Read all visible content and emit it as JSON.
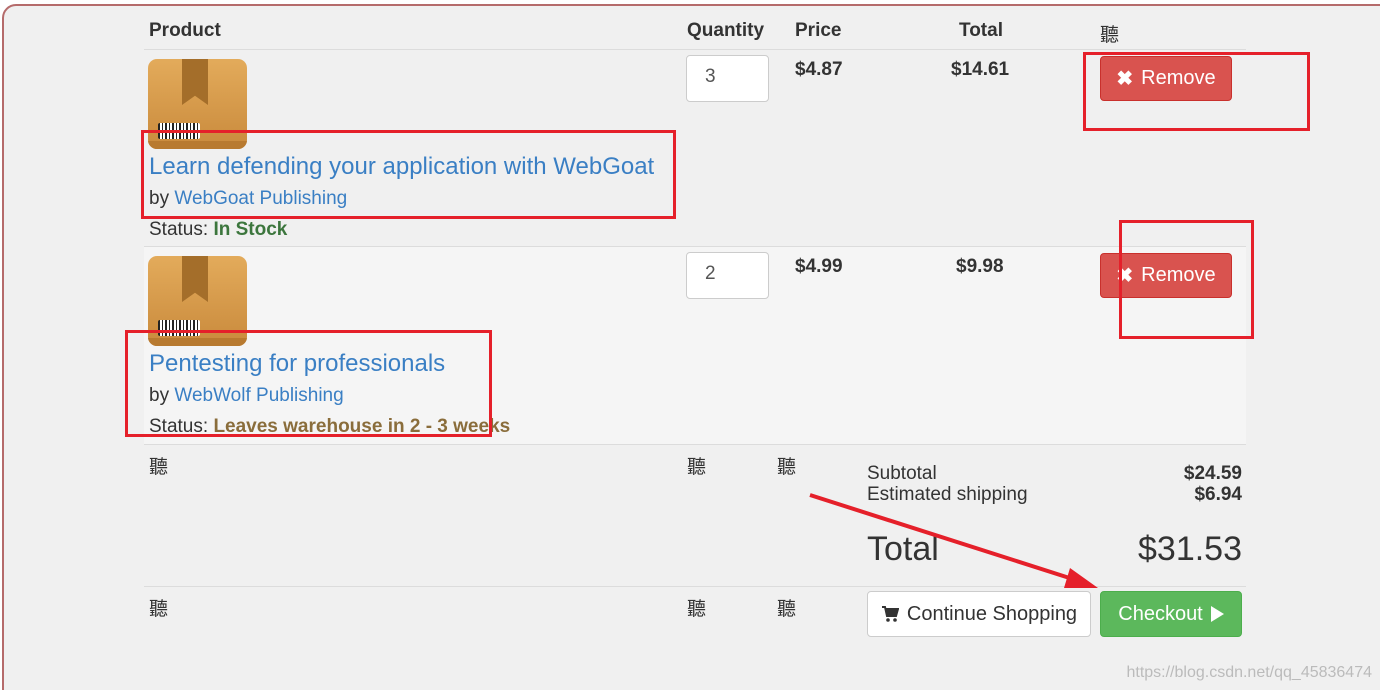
{
  "columns": {
    "product": "Product",
    "quantity": "Quantity",
    "price": "Price",
    "total": "Total",
    "extra": "聽"
  },
  "items": [
    {
      "title": "Learn defending your application with WebGoat",
      "by_prefix": "by",
      "publisher": "WebGoat Publishing",
      "status_label": "Status:",
      "status": "In Stock",
      "quantity": "3",
      "price": "$4.87",
      "total": "$14.61",
      "remove_label": "Remove"
    },
    {
      "title": "Pentesting for professionals",
      "by_prefix": "by",
      "publisher": "WebWolf Publishing",
      "status_label": "Status:",
      "status": "Leaves warehouse in 2 - 3 weeks",
      "quantity": "2",
      "price": "$4.99",
      "total": "$9.98",
      "remove_label": "Remove"
    }
  ],
  "filler_glyph": "聽",
  "summary": {
    "subtotal_label": "Subtotal",
    "subtotal_value": "$24.59",
    "shipping_label": "Estimated shipping",
    "shipping_value": "$6.94",
    "total_label": "Total",
    "total_value": "$31.53"
  },
  "actions": {
    "continue_label": "Continue Shopping",
    "checkout_label": "Checkout"
  },
  "watermark": "https://blog.csdn.net/qq_45836474",
  "colors": {
    "link": "#3a7fc4",
    "remove": "#d9534f",
    "checkout": "#5cb85c",
    "in_stock": "#3c763d",
    "leaves": "#8a6d3b",
    "annotation": "#e5202a"
  },
  "icons": {
    "remove": "times-icon",
    "continue": "shopping-cart-icon",
    "checkout": "play-icon",
    "product": "package-icon"
  }
}
